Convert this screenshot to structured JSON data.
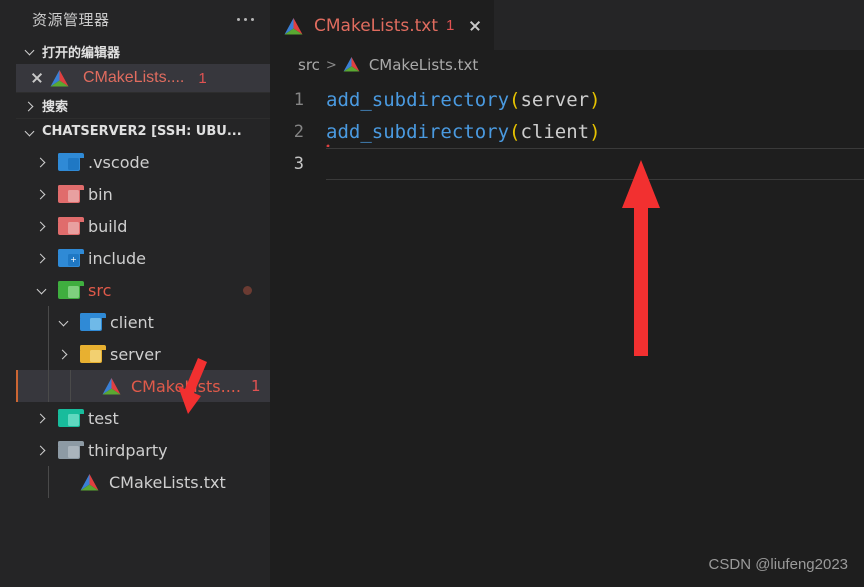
{
  "sidebar": {
    "title": "资源管理器",
    "more_icon": "ellipsis-icon",
    "open_editors": {
      "label": "打开的编辑器",
      "items": [
        {
          "name": "CMakeLists....",
          "badge": "1",
          "icon": "cmake-icon",
          "close_icon": "close-icon"
        }
      ]
    },
    "search": {
      "label": "搜索"
    },
    "workspace": {
      "label": "CHATSERVER2 [SSH: UBU...",
      "tree": [
        {
          "name": ".vscode",
          "type": "folder",
          "icon": "folder-vscode-icon",
          "depth": 1,
          "expanded": false,
          "color": "#2f8ad6",
          "tint": "#1f78c4",
          "glyph": "",
          "text_color": "#cfcfcf"
        },
        {
          "name": "bin",
          "type": "folder",
          "icon": "folder-bin-icon",
          "depth": 1,
          "expanded": false,
          "color": "#e06c6c",
          "tint": "#e8a0a0",
          "glyph": "",
          "text_color": "#cfcfcf"
        },
        {
          "name": "build",
          "type": "folder",
          "icon": "folder-build-icon",
          "depth": 1,
          "expanded": false,
          "color": "#e06c6c",
          "tint": "#e8a0a0",
          "glyph": "",
          "text_color": "#cfcfcf"
        },
        {
          "name": "include",
          "type": "folder",
          "icon": "folder-include-icon",
          "depth": 1,
          "expanded": false,
          "color": "#2f8ad6",
          "tint": "#1f78c4",
          "glyph": "+",
          "text_color": "#cfcfcf"
        },
        {
          "name": "src",
          "type": "folder",
          "icon": "folder-src-icon",
          "depth": 1,
          "expanded": true,
          "color": "#3fae3f",
          "tint": "#7ed07e",
          "glyph": "</>",
          "text_color": "#e05a4a",
          "modified_dot": true
        },
        {
          "name": "client",
          "type": "folder",
          "icon": "folder-client-icon",
          "depth": 2,
          "expanded": true,
          "color": "#2f8ad6",
          "tint": "#6fb9e8",
          "glyph": "",
          "text_color": "#cfcfcf"
        },
        {
          "name": "server",
          "type": "folder",
          "icon": "folder-server-icon",
          "depth": 2,
          "expanded": false,
          "color": "#e8b030",
          "tint": "#f2d070",
          "glyph": "",
          "text_color": "#cfcfcf"
        },
        {
          "name": "CMakeLists....",
          "type": "file",
          "icon": "cmake-icon",
          "depth": 3,
          "selected": true,
          "badge": "1",
          "text_color": "#e05a4a"
        },
        {
          "name": "test",
          "type": "folder",
          "icon": "folder-test-icon",
          "depth": 1,
          "expanded": false,
          "color": "#18bc9c",
          "tint": "#5fd8c0",
          "glyph": "",
          "text_color": "#cfcfcf"
        },
        {
          "name": "thirdparty",
          "type": "folder",
          "icon": "folder-thirdparty-icon",
          "depth": 1,
          "expanded": false,
          "color": "#8d9aa4",
          "tint": "#aab4bc",
          "glyph": "",
          "text_color": "#cfcfcf"
        },
        {
          "name": "CMakeLists.txt",
          "type": "file",
          "icon": "cmake-icon",
          "depth": 2,
          "text_color": "#cfcfcf"
        }
      ]
    }
  },
  "editor": {
    "tab": {
      "title": "CMakeLists.txt",
      "badge": "1",
      "icon": "cmake-icon",
      "close_icon": "close-icon"
    },
    "breadcrumb": {
      "folder": "src",
      "separator": ">",
      "file": "CMakeLists.txt",
      "icon": "cmake-icon"
    },
    "lines": [
      {
        "number": "1",
        "fn": "add_subdirectory",
        "open": "(",
        "arg": "server",
        "close": ")",
        "error": false,
        "active": false
      },
      {
        "number": "2",
        "fn": "add_subdirectory",
        "open": "(",
        "arg": "client",
        "close": ")",
        "error": true,
        "active": false
      },
      {
        "number": "3",
        "fn": "",
        "open": "",
        "arg": "",
        "close": "",
        "error": false,
        "active": true
      }
    ]
  },
  "annotations": {
    "big_arrow": {
      "color": "#f23030",
      "points_to": "line-3"
    },
    "small_arrow": {
      "color": "#f23030",
      "points_to": "src-cmakelists-file"
    }
  },
  "watermark": "CSDN @liufeng2023",
  "colors": {
    "sidebar_bg": "#252526",
    "editor_bg": "#1e1e1e",
    "selection_bg": "#37373d",
    "accent_red": "#e05a4a",
    "function_blue": "#4a9ae0",
    "paren_yellow": "#e6c200",
    "error_red": "#e04040"
  }
}
